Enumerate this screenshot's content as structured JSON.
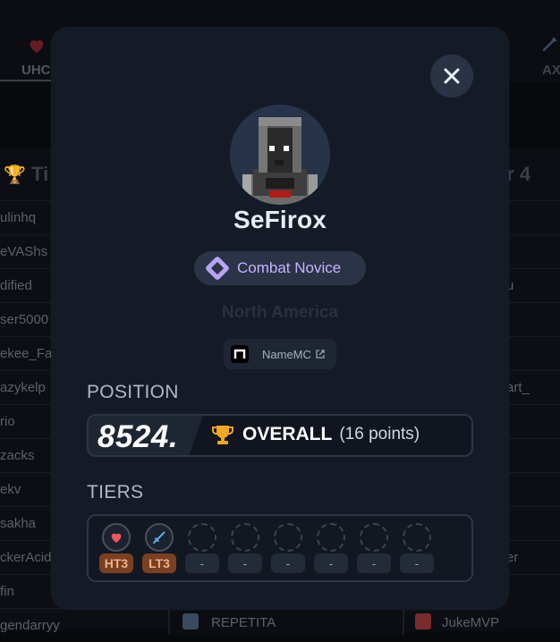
{
  "background": {
    "tabs": {
      "left": "UHC",
      "right": "AX"
    },
    "left_column_heading": "Ti",
    "right_column_heading": "er 4",
    "left_rows": [
      "ulinhq",
      "eVAShs",
      "dified",
      "ser5000",
      "ekee_Fa",
      "azykelp",
      "rio",
      "zacks",
      "ekv",
      "sakha",
      "ckerAcid",
      "fin",
      "gendarryy"
    ],
    "right_rows": [
      "",
      "",
      "u",
      "",
      "",
      "art_",
      "",
      "",
      "",
      "",
      "er",
      ""
    ],
    "bottom_mid_name": "REPETITA",
    "bottom_right_name": "JukeMVP"
  },
  "modal": {
    "close_icon": "close-icon",
    "player": {
      "name": "SeFirox"
    },
    "rank": {
      "label": "Combat Novice",
      "icon": "diamond-rank-icon",
      "color": "#c7b2ff"
    },
    "region": "North America",
    "namemc": {
      "label": "NameMC",
      "icon": "external-link-icon"
    },
    "position_section": {
      "heading": "POSITION",
      "rank_number": "8524.",
      "overall_label": "OVERALL",
      "points": "(16 points)",
      "trophy_color": "#f5a623"
    },
    "tiers_section": {
      "heading": "TIERS",
      "tiers": [
        {
          "label": "HT3",
          "icon": "heart-icon",
          "filled": true
        },
        {
          "label": "LT3",
          "icon": "sword-icon",
          "filled": true
        },
        {
          "label": "-",
          "icon": "empty-slot-icon",
          "filled": false
        },
        {
          "label": "-",
          "icon": "empty-slot-icon",
          "filled": false
        },
        {
          "label": "-",
          "icon": "empty-slot-icon",
          "filled": false
        },
        {
          "label": "-",
          "icon": "empty-slot-icon",
          "filled": false
        },
        {
          "label": "-",
          "icon": "empty-slot-icon",
          "filled": false
        },
        {
          "label": "-",
          "icon": "empty-slot-icon",
          "filled": false
        }
      ]
    }
  }
}
